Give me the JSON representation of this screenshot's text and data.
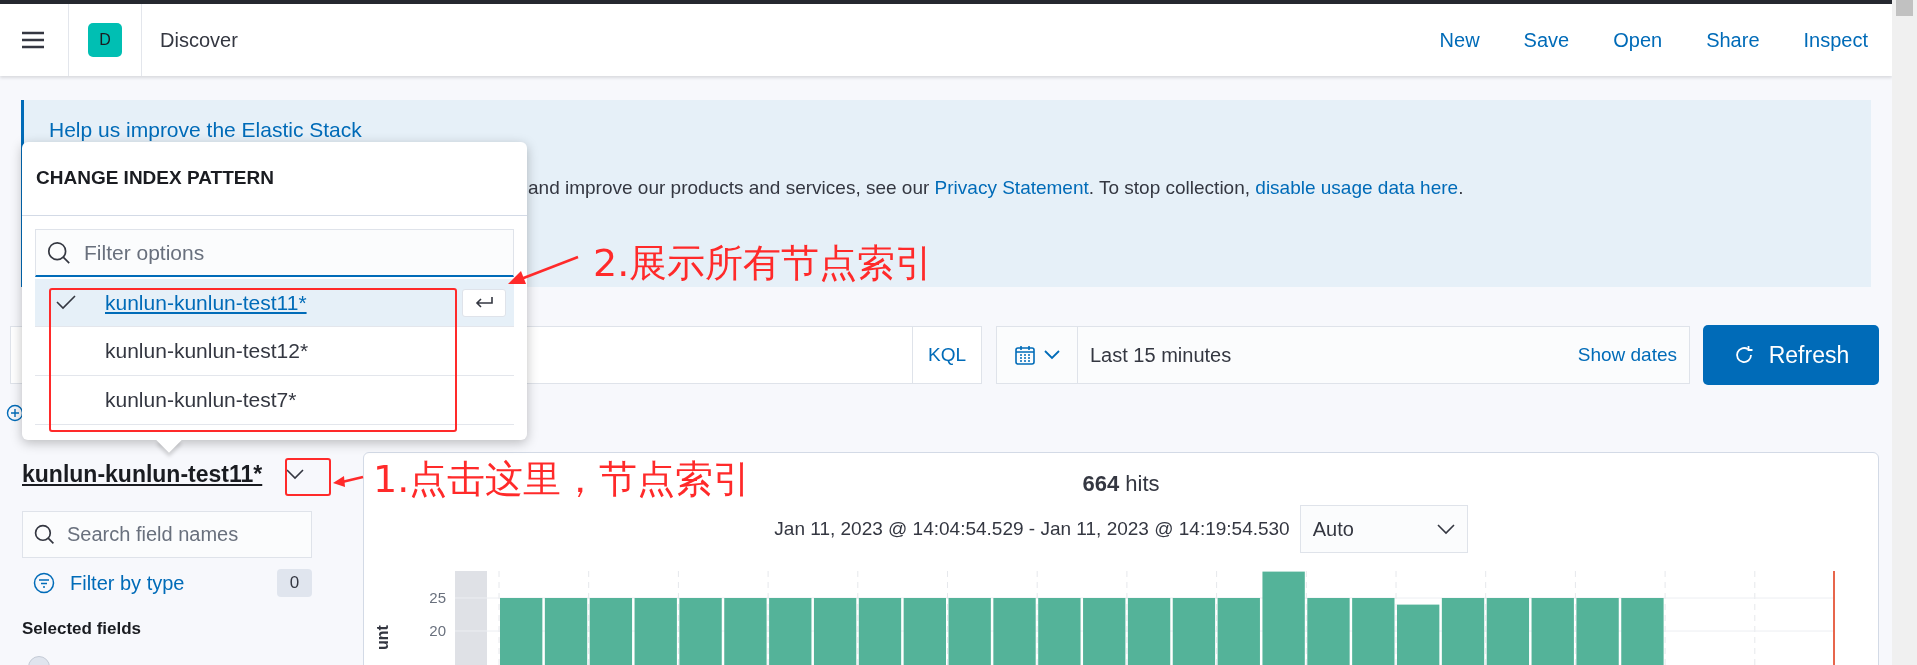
{
  "header": {
    "app_badge": "D",
    "title": "Discover",
    "nav": [
      "New",
      "Save",
      "Open",
      "Share",
      "Inspect"
    ]
  },
  "notice": {
    "title": "Help us improve the Elastic Stack",
    "body": [
      {
        "kind": "text",
        "text": "and improve our products and services, see our "
      },
      {
        "kind": "link",
        "text": "Privacy Statement"
      },
      {
        "kind": "text",
        "text": ". To stop collection, "
      },
      {
        "kind": "link",
        "text": "disable usage data here"
      },
      {
        "kind": "text",
        "text": "."
      }
    ]
  },
  "query_bar": {
    "language": "KQL",
    "time_range": "Last 15 minutes",
    "show_dates": "Show dates",
    "refresh": "Refresh"
  },
  "index_popover": {
    "title": "CHANGE INDEX PATTERN",
    "filter_placeholder": "Filter options",
    "options": [
      {
        "label": "kunlun-kunlun-test11*",
        "selected": true
      },
      {
        "label": "kunlun-kunlun-test12*",
        "selected": false
      },
      {
        "label": "kunlun-kunlun-test7*",
        "selected": false
      }
    ]
  },
  "sidebar": {
    "index_pattern": "kunlun-kunlun-test11*",
    "search_placeholder": "Search field names",
    "filter_label": "Filter by type",
    "filter_count": "0",
    "section": "Selected fields"
  },
  "results": {
    "hits": "**664** hits",
    "time_range": "Jan 11, 2023 @ 14:04:54.529 - Jan 11, 2023 @ 14:19:54.530",
    "interval": "Auto",
    "chart_data": {
      "type": "bar",
      "ylabel": "unt",
      "ylim": [
        0,
        29
      ],
      "yticks": [
        20,
        25
      ],
      "grid": true,
      "series": [
        {
          "color": "#54b399",
          "values": [
            null,
            25,
            25,
            25,
            25,
            25,
            25,
            25,
            25,
            25,
            25,
            25,
            25,
            25,
            25,
            25,
            25,
            25,
            29,
            25,
            25,
            24,
            25,
            25,
            25,
            25,
            25,
            null,
            null,
            null,
            null
          ]
        }
      ]
    }
  },
  "annotations": [
    {
      "text": "2.展示所有节点索引"
    },
    {
      "text": "1.点击这里，节点索引"
    }
  ]
}
